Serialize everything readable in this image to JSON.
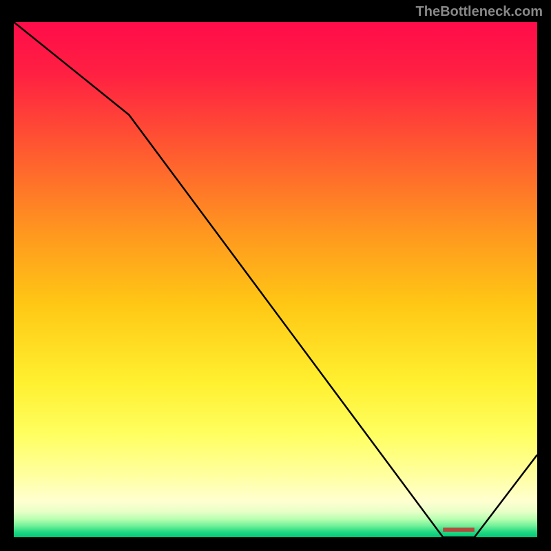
{
  "watermark": "TheBottleneck.com",
  "chart_data": {
    "type": "line",
    "title": "",
    "xlabel": "",
    "ylabel": "",
    "x": [
      0,
      22,
      82,
      88,
      100
    ],
    "values": [
      100,
      82,
      0,
      0,
      16
    ],
    "ylim": [
      0,
      100
    ],
    "xlim": [
      0,
      100
    ],
    "gradient_stops": [
      {
        "pos": 0.0,
        "color": "#ff0c4a"
      },
      {
        "pos": 0.1,
        "color": "#ff2042"
      },
      {
        "pos": 0.25,
        "color": "#ff5a30"
      },
      {
        "pos": 0.4,
        "color": "#ff9420"
      },
      {
        "pos": 0.55,
        "color": "#ffc814"
      },
      {
        "pos": 0.7,
        "color": "#fff030"
      },
      {
        "pos": 0.8,
        "color": "#ffff60"
      },
      {
        "pos": 0.88,
        "color": "#ffffa0"
      },
      {
        "pos": 0.93,
        "color": "#ffffd0"
      },
      {
        "pos": 0.95,
        "color": "#e8ffc8"
      },
      {
        "pos": 0.965,
        "color": "#b8ffb0"
      },
      {
        "pos": 0.978,
        "color": "#70f098"
      },
      {
        "pos": 0.99,
        "color": "#20d882"
      },
      {
        "pos": 1.0,
        "color": "#00c878"
      }
    ],
    "marker": {
      "label": "",
      "x": 85,
      "color": "#c83030"
    }
  }
}
